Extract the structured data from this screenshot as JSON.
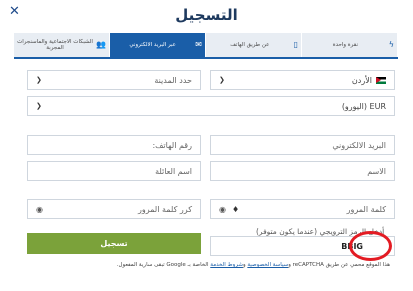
{
  "title": "التسجيل",
  "close_label": "✕",
  "tabs": [
    {
      "label": "الشبكات الاجتماعية والماسنجرات المجربة",
      "icon": "people-icon",
      "active": false
    },
    {
      "label": "عبر البريد الالكتروني",
      "icon": "envelope-icon",
      "active": true
    },
    {
      "label": "عن طريق الهاتف",
      "icon": "phone-icon",
      "active": false
    },
    {
      "label": "نقرة واحدة",
      "icon": "lightning-icon",
      "active": false
    }
  ],
  "country": {
    "value": "الأردن"
  },
  "city": {
    "placeholder": "حدد المدينة"
  },
  "currency": {
    "value": "EUR (اليورو)"
  },
  "email": {
    "placeholder": "البريد الالكتروني"
  },
  "phone": {
    "placeholder": "رقم الهاتف:"
  },
  "first_name": {
    "placeholder": "الاسم"
  },
  "last_name": {
    "placeholder": "اسم العائلة"
  },
  "password": {
    "placeholder": "كلمة المرور"
  },
  "password_repeat": {
    "placeholder": "كرر كلمة المرور"
  },
  "promo": {
    "label": "أدخل الرمز الترويجي (عندما يكون متوفر)",
    "value": "BBIG"
  },
  "register_button": "تسجيل",
  "recaptcha_note": {
    "prefix": "هذا الموقع محمي عن طريق reCAPTCHA و",
    "privacy_link": "سياسة الخصوصية",
    "middle": " و",
    "terms_link": "شروط الخدمة",
    "suffix": " الخاصة بـ Google تبقى سارية المفعول."
  },
  "colors": {
    "accent": "#1a5ea8",
    "button": "#7ba23a",
    "highlight_ring": "#e31b23"
  }
}
